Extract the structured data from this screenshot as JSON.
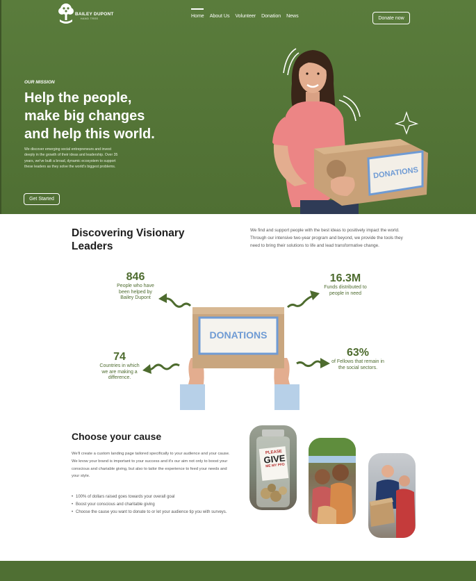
{
  "brand": {
    "name": "BAILEY DUPONT",
    "tagline": "HAND TREE"
  },
  "nav": {
    "items": [
      {
        "label": "Home",
        "active": true
      },
      {
        "label": "About Us",
        "active": false
      },
      {
        "label": "Volunteer",
        "active": false
      },
      {
        "label": "Donation",
        "active": false
      },
      {
        "label": "News",
        "active": false
      }
    ],
    "cta_label": "Donate now"
  },
  "hero": {
    "eyebrow": "OUR MISSION",
    "title_lines": [
      "Help the people,",
      "make big changes",
      "and help this world."
    ],
    "description": "We discover emerging social entrepreneurs and invest deeply in the growth of their ideas and leadership. Over 35 years, we've built a broad, dynamic ecosystem to support these leaders as they solve the world's biggest problems.",
    "button_label": "Get Started",
    "box_label": "DONATIONS"
  },
  "discover": {
    "title": "Discovering Visionary Leaders",
    "description": "We find and support people with the best ideas to positively impact the world. Through our intensive two-year program and beyond, we provide the tools they need to bring their solutions to life and lead transformative change.",
    "box_label": "DONATIONS",
    "stats": [
      {
        "value": "846",
        "text": "People who have been helped by Bailey Dupont"
      },
      {
        "value": "16.3M",
        "text": "Funds distributed to people in need"
      },
      {
        "value": "74",
        "text": "Countries in which we are making a difference."
      },
      {
        "value": "63%",
        "text": "of Fellows that remain in the social sectors."
      }
    ]
  },
  "cause": {
    "title": "Choose your cause",
    "description": "We'll create a custom landing page tailored specifically to your audience and your cause. We know your brand is important to your success and it's our aim not only to boost your conscious and chariable giving, but also to tailor the experience to feed your needs and your style.",
    "bullets": [
      "100% of dollars raised goes towards your overall goal",
      "Boost your conscious and charitable giving",
      "Choose the cause you want to donate to or let your audience tip you with surveys."
    ],
    "jar_sign": [
      "PLEASE",
      "GIVE",
      "ME MY PFD"
    ]
  },
  "colors": {
    "brand_green": "#4f6f33",
    "stat_green": "#4d6b2e",
    "box_blue": "#6f9bd4"
  }
}
